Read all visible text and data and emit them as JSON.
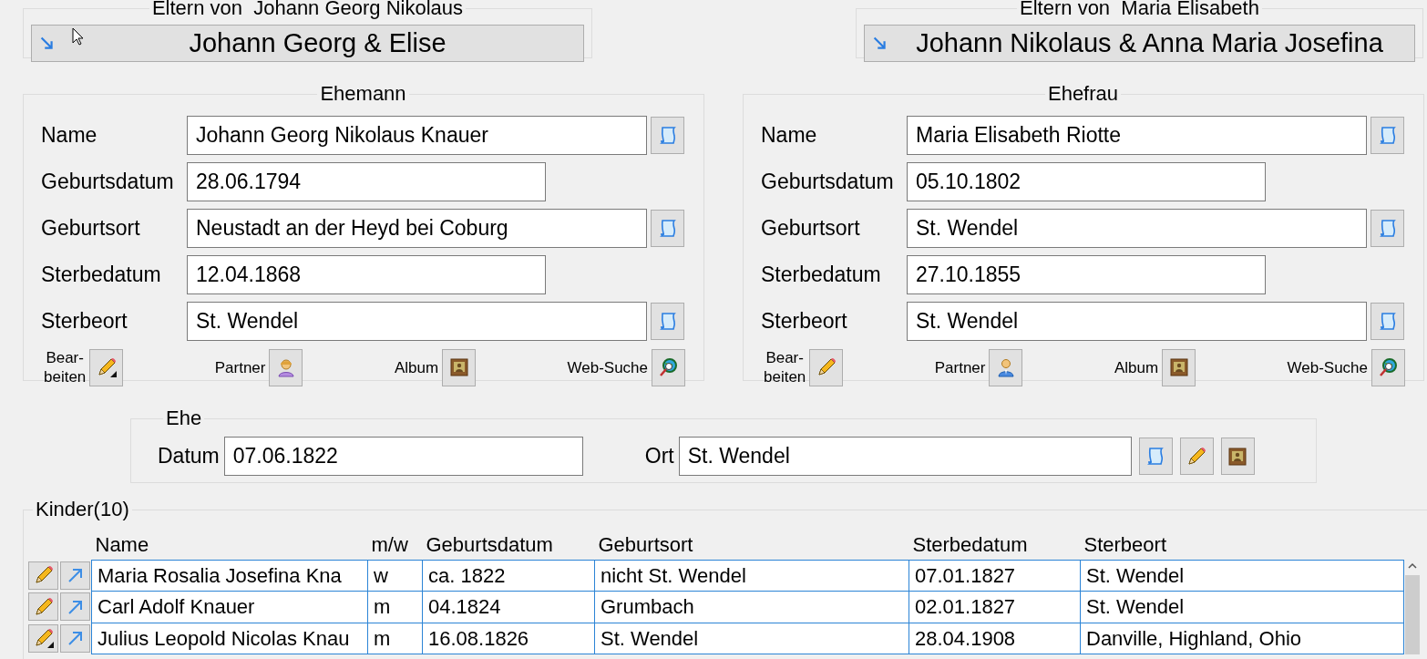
{
  "parents": [
    {
      "title": "Eltern von  Johann Georg Nikolaus",
      "couple": "Johann Georg & Elise"
    },
    {
      "title": "Eltern von  Maria Elisabeth",
      "couple": "Johann Nikolaus & Anna Maria Josefina"
    }
  ],
  "spouses": [
    {
      "title": "Ehemann",
      "fields": [
        {
          "kind": "place",
          "label": "Name",
          "value": "Johann Georg Nikolaus Knauer"
        },
        {
          "kind": "date",
          "label": "Geburtsdatum",
          "value": "28.06.1794"
        },
        {
          "kind": "place",
          "label": "Geburtsort",
          "value": "Neustadt an der Heyd bei Coburg"
        },
        {
          "kind": "date",
          "label": "Sterbedatum",
          "value": "12.04.1868"
        },
        {
          "kind": "place",
          "label": "Sterbeort",
          "value": "St. Wendel"
        }
      ],
      "actions": [
        {
          "kind": "edit",
          "label": "Bear-\nbeiten",
          "marked": true
        },
        {
          "kind": "partner_female",
          "label": "Partner"
        },
        {
          "kind": "album",
          "label": "Album"
        },
        {
          "kind": "web",
          "label": "Web-Suche"
        }
      ]
    },
    {
      "title": "Ehefrau",
      "fields": [
        {
          "kind": "place",
          "label": "Name",
          "value": "Maria Elisabeth Riotte"
        },
        {
          "kind": "date",
          "label": "Geburtsdatum",
          "value": "05.10.1802"
        },
        {
          "kind": "place",
          "label": "Geburtsort",
          "value": "St. Wendel"
        },
        {
          "kind": "date",
          "label": "Sterbedatum",
          "value": "27.10.1855"
        },
        {
          "kind": "place",
          "label": "Sterbeort",
          "value": "St. Wendel"
        }
      ],
      "actions": [
        {
          "kind": "edit",
          "label": "Bear-\nbeiten",
          "marked": false
        },
        {
          "kind": "partner_male",
          "label": "Partner"
        },
        {
          "kind": "album",
          "label": "Album"
        },
        {
          "kind": "web",
          "label": "Web-Suche"
        }
      ]
    }
  ],
  "marriage": {
    "title": "Ehe",
    "date_label": "Datum",
    "date": "07.06.1822",
    "place_label": "Ort",
    "place": "St. Wendel"
  },
  "children": {
    "title": "Kinder(10)",
    "columns": [
      "Name",
      "m/w",
      "Geburtsdatum",
      "Geburtsort",
      "Sterbedatum",
      "Sterbeort"
    ],
    "rows": [
      {
        "marked": false,
        "cells": [
          "Maria Rosalia Josefina Kna",
          "w",
          "ca. 1822",
          "nicht St. Wendel",
          "07.01.1827",
          "St. Wendel"
        ]
      },
      {
        "marked": false,
        "cells": [
          "Carl Adolf Knauer",
          "m",
          "04.1824",
          "Grumbach",
          "02.01.1827",
          "St. Wendel"
        ]
      },
      {
        "marked": true,
        "cells": [
          "Julius Leopold Nicolas Knau",
          "m",
          "16.08.1826",
          "St. Wendel",
          "28.04.1908",
          "Danville, Highland, Ohio"
        ]
      }
    ]
  }
}
